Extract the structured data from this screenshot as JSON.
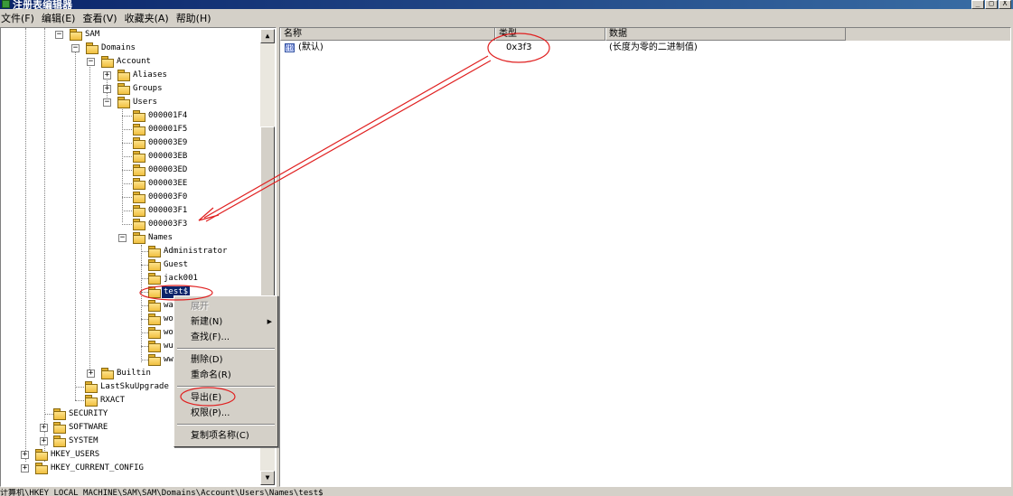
{
  "window": {
    "title": "注册表编辑器",
    "buttons": [
      "_",
      "□",
      "X"
    ]
  },
  "menu": [
    "文件(F)",
    "编辑(E)",
    "查看(V)",
    "收藏夹(A)",
    "帮助(H)"
  ],
  "tree": {
    "nodes": {
      "sam": "SAM",
      "domains": "Domains",
      "account": "Account",
      "aliases": "Aliases",
      "groups": "Groups",
      "users": "Users",
      "u1f4": "000001F4",
      "u1f5": "000001F5",
      "u3e9": "000003E9",
      "u3eb": "000003EB",
      "u3ed": "000003ED",
      "u3ee": "000003EE",
      "u3f0": "000003F0",
      "u3f1": "000003F1",
      "u3f3": "000003F3",
      "names": "Names",
      "administrator": "Administrator",
      "guest": "Guest",
      "jack001": "jack001",
      "test": "test$",
      "wa": "wa",
      "wo1": "wo",
      "wo2": "wo",
      "wu": "wu",
      "ww": "ww",
      "builtin": "Builtin",
      "lastsku": "LastSkuUpgrade",
      "rxact": "RXACT",
      "security": "SECURITY",
      "software": "SOFTWARE",
      "system": "SYSTEM",
      "hku": "HKEY_USERS",
      "hkcc": "HKEY_CURRENT_CONFIG"
    }
  },
  "values": {
    "columns": [
      "名称",
      "类型",
      "数据"
    ],
    "rows": [
      {
        "name": "(默认)",
        "type": "0x3f3",
        "data": "(长度为零的二进制值)",
        "icon": "binary-value-icon"
      }
    ]
  },
  "context_menu": {
    "items": {
      "expand": "展开",
      "new": "新建(N)",
      "find": "查找(F)...",
      "delete": "删除(D)",
      "rename": "重命名(R)",
      "export": "导出(E)",
      "permissions": "权限(P)...",
      "copy_key_name": "复制项名称(C)"
    }
  },
  "statusbar": {
    "path": "计算机\\HKEY_LOCAL_MACHINE\\SAM\\SAM\\Domains\\Account\\Users\\Names\\test$"
  },
  "colors": {
    "title_bar": "#0a246a",
    "selection": "#0a246a",
    "annotation": "#e02020",
    "folder": "#f0c040"
  }
}
